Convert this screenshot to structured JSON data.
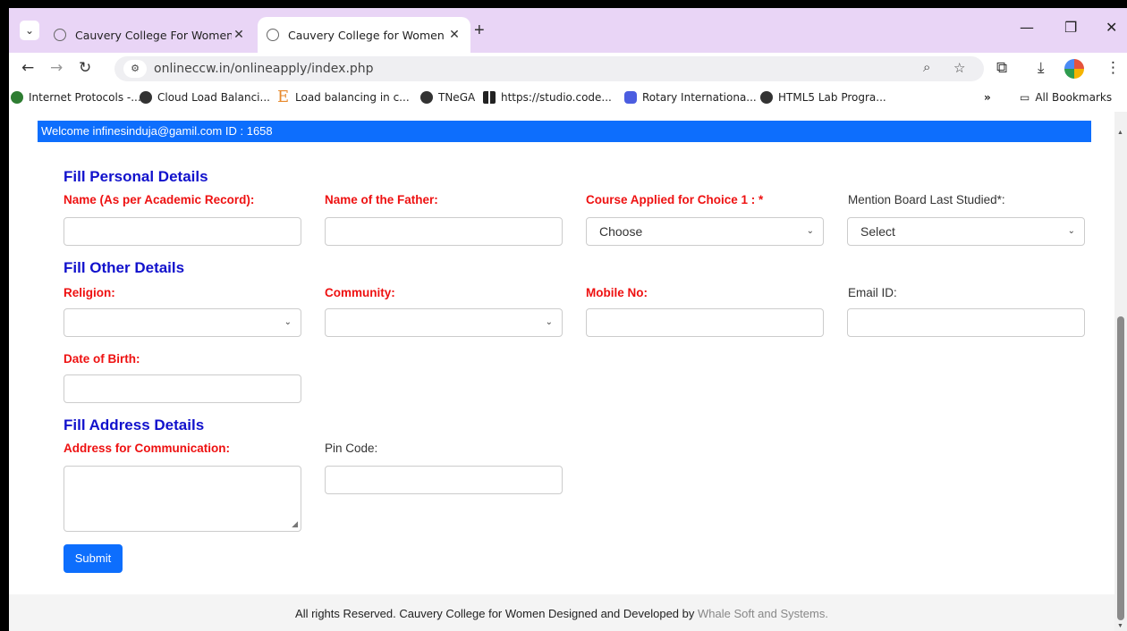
{
  "browser": {
    "tabs": [
      {
        "title": "Cauvery College For Women",
        "active": false
      },
      {
        "title": "Cauvery College for Women - (",
        "active": true
      }
    ],
    "url": "onlineccw.in/onlineapply/index.php",
    "bookmarks": [
      "Internet Protocols -...",
      "Cloud Load Balanci...",
      "Load balancing in c...",
      "TNeGA",
      "https://studio.code...",
      "Rotary Internationa...",
      "HTML5 Lab Progra..."
    ],
    "all_bookmarks": "All Bookmarks"
  },
  "page": {
    "welcome": "Welcome infinesinduja@gamil.com ID : 1658",
    "personal": {
      "title": "Fill Personal Details",
      "name_label": "Name (As per Academic Record):",
      "father_label": "Name of the Father:",
      "course_label": "Course Applied for Choice 1 : *",
      "course_value": "Choose",
      "board_label": "Mention Board Last Studied*:",
      "board_value": "Select"
    },
    "other": {
      "title": "Fill Other Details",
      "religion_label": "Religion:",
      "community_label": "Community:",
      "mobile_label": "Mobile No:",
      "email_label": "Email ID:",
      "dob_label": "Date of Birth:"
    },
    "address": {
      "title": "Fill Address Details",
      "address_label": "Address for Communication:",
      "pincode_label": "Pin Code:"
    },
    "submit_label": "Submit",
    "footer_text": "All rights Reserved. Cauvery College for Women Designed and Developed by ",
    "footer_link": "Whale Soft and Systems."
  },
  "colors": {
    "accent": "#0d6efd",
    "required_label": "#ee1111",
    "section_title": "#1111cc",
    "tabbar": "#e9d5f6"
  }
}
